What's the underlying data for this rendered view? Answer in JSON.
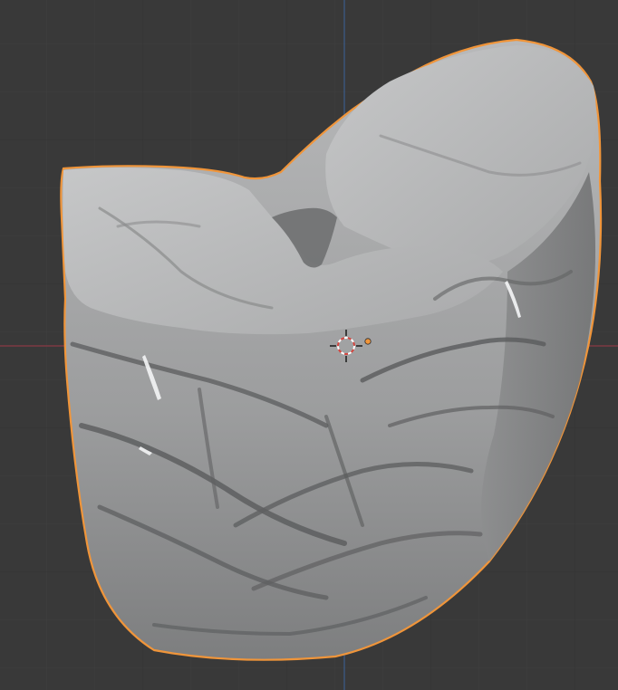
{
  "app": {
    "name": "3D viewport"
  },
  "viewport": {
    "background_color": "#393939",
    "grid_minor_color": "#404040",
    "grid_major_color": "#2f2f2f",
    "x_axis_color": "#8a3a44",
    "y_axis_color": "#3b5c8c"
  },
  "scene": {
    "object": {
      "name": "",
      "kind": "sculpted brain-slice mesh",
      "selected": true,
      "active": true,
      "shading": "solid",
      "base_color": "#b4b5b6",
      "outline_color": "#f0953a"
    },
    "cursor_3d": {
      "icon": "3d-cursor-icon",
      "ring_colors": [
        "#d4453f",
        "#ffffff"
      ]
    },
    "origin": {
      "icon": "origin-dot-icon",
      "color": "#f0953a"
    }
  }
}
